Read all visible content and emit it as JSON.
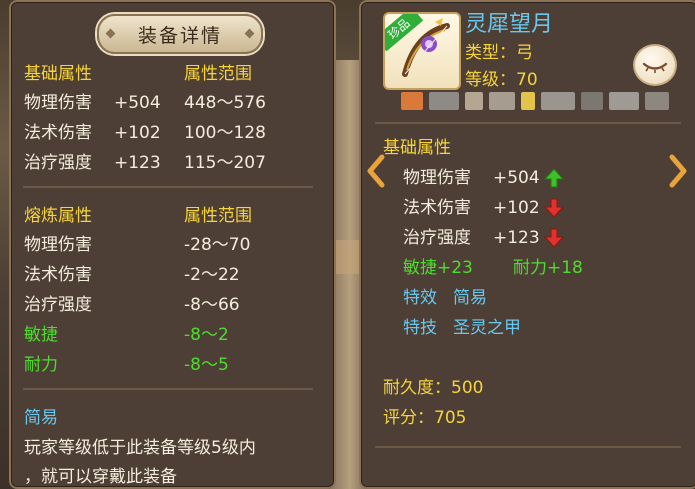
{
  "left_panel": {
    "title": "装备详情",
    "base_section": {
      "heading": "基础属性",
      "range_heading": "属性范围"
    },
    "base_rows": [
      {
        "name": "物理伤害",
        "value": "+504",
        "range": "448～576"
      },
      {
        "name": "法术伤害",
        "value": "+102",
        "range": "100～128"
      },
      {
        "name": "治疗强度",
        "value": "+123",
        "range": "115～207"
      }
    ],
    "refine_section": {
      "heading": "熔炼属性",
      "range_heading": "属性范围"
    },
    "refine_rows": [
      {
        "name": "物理伤害",
        "range": "-28～70",
        "color": "white"
      },
      {
        "name": "法术伤害",
        "range": "-2～22",
        "color": "white"
      },
      {
        "name": "治疗强度",
        "range": "-8～66",
        "color": "white"
      },
      {
        "name": "敏捷",
        "range": "-8～2",
        "color": "green"
      },
      {
        "name": "耐力",
        "range": "-8～5",
        "color": "green"
      }
    ],
    "effect_name": "简易",
    "effect_desc_line1": "玩家等级低于此装备等级5级内",
    "effect_desc_line2": "，就可以穿戴此装备"
  },
  "right_panel": {
    "badge": "珍品",
    "item_name": "灵犀望月",
    "type_label": "类型：弓",
    "level_label": "等级：70",
    "base_heading": "基础属性",
    "stats": [
      {
        "name": "物理伤害",
        "value": "+504",
        "trend": "up"
      },
      {
        "name": "法术伤害",
        "value": "+102",
        "trend": "down"
      },
      {
        "name": "治疗强度",
        "value": "+123",
        "trend": "down"
      }
    ],
    "bonus_agility": "敏捷+23",
    "bonus_stamina": "耐力+18",
    "effect_label": "特效",
    "effect_value": "简易",
    "skill_label": "特技",
    "skill_value": "圣灵之甲",
    "durability": "耐久度：500",
    "score": "评分：705"
  },
  "colors": {
    "yellow": "#f6d43a",
    "green": "#4fdc2e",
    "cyan": "#68c8ee",
    "up_arrow": "#3fbf2a",
    "down_arrow": "#e0322a"
  },
  "icons": [
    "eye-closed-icon",
    "chevron-left-icon",
    "chevron-right-icon",
    "arrow-up-icon",
    "arrow-down-icon",
    "bow-item-icon"
  ]
}
